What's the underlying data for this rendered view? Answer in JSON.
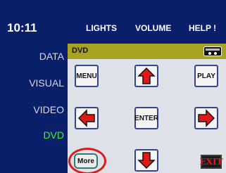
{
  "status": {
    "time": "10:11"
  },
  "top_nav": {
    "lights": "LIGHTS",
    "volume": "VOLUME",
    "help": "HELP !"
  },
  "sidebar": {
    "items": [
      {
        "label": "DATA",
        "active": false
      },
      {
        "label": "VISUAL",
        "active": false
      },
      {
        "label": "VIDEO",
        "active": false
      },
      {
        "label": "DVD",
        "active": true
      }
    ]
  },
  "panel": {
    "title": "DVD",
    "buttons": {
      "menu": "MENU",
      "play": "PLAY",
      "enter": "ENTER",
      "more": "More",
      "exit": "EXIT"
    }
  },
  "colors": {
    "background": "#0a1f6a",
    "panel_header": "#a7a322",
    "active_nav": "#3ef23e",
    "arrow_fill": "#e01818",
    "button_border": "#35458a",
    "highlight_ring": "#e01818"
  },
  "icons": {
    "disc": "disc-tray-icon",
    "up": "arrow-up-icon",
    "down": "arrow-down-icon",
    "left": "arrow-left-icon",
    "right": "arrow-right-icon"
  }
}
